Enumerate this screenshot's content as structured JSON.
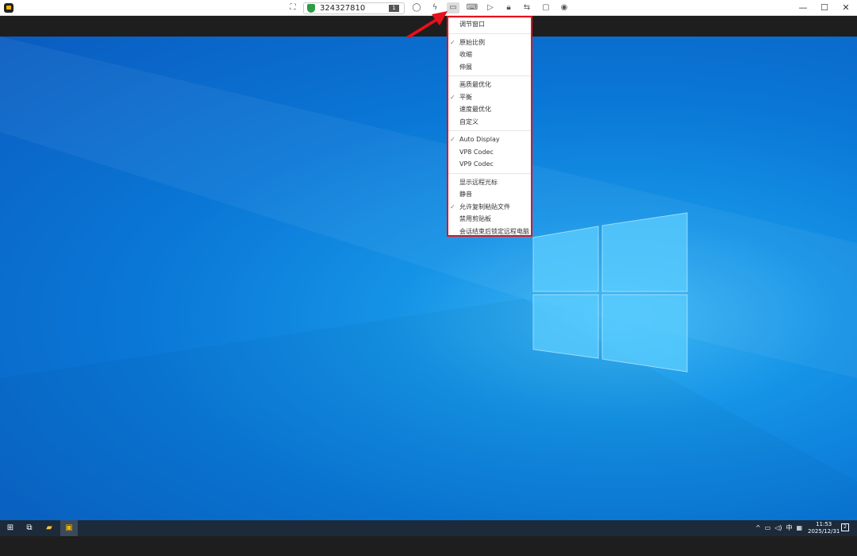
{
  "toolbar": {
    "connection_id": "324327810",
    "display_badge": "1",
    "icons": [
      "fullscreen-icon",
      "chat-icon",
      "lightning-icon",
      "display-icon",
      "keyboard-icon",
      "record-icon",
      "lock-icon",
      "transfer-icon",
      "remote-screen-icon",
      "view-icon"
    ]
  },
  "window_controls": {
    "minimize": "—",
    "maximize": "☐",
    "close": "✕"
  },
  "menu": {
    "groups": [
      [
        {
          "label": "调节窗口",
          "checked": false
        }
      ],
      [
        {
          "label": "原始比例",
          "checked": true
        },
        {
          "label": "收缩",
          "checked": false
        },
        {
          "label": "伸展",
          "checked": false
        }
      ],
      [
        {
          "label": "画质最优化",
          "checked": false
        },
        {
          "label": "平衡",
          "checked": true
        },
        {
          "label": "速度最优化",
          "checked": false
        },
        {
          "label": "自定义",
          "checked": false
        }
      ],
      [
        {
          "label": "Auto Display",
          "checked": true
        },
        {
          "label": "VP8 Codec",
          "checked": false
        },
        {
          "label": "VP9 Codec",
          "checked": false
        }
      ],
      [
        {
          "label": "显示远程光标",
          "checked": false
        },
        {
          "label": "静音",
          "checked": false
        },
        {
          "label": "允许复制粘贴文件",
          "checked": true
        },
        {
          "label": "禁用剪贴板",
          "checked": false
        },
        {
          "label": "会话结束后锁定远程电脑",
          "checked": false
        }
      ]
    ]
  },
  "taskbar": {
    "tray": {
      "chevron": "^",
      "ime": "中",
      "time": "11:53",
      "date": "2025/12/31",
      "notifications": "2"
    }
  },
  "colors": {
    "highlight": "#e8101a",
    "desktop": "#0a77d6"
  }
}
